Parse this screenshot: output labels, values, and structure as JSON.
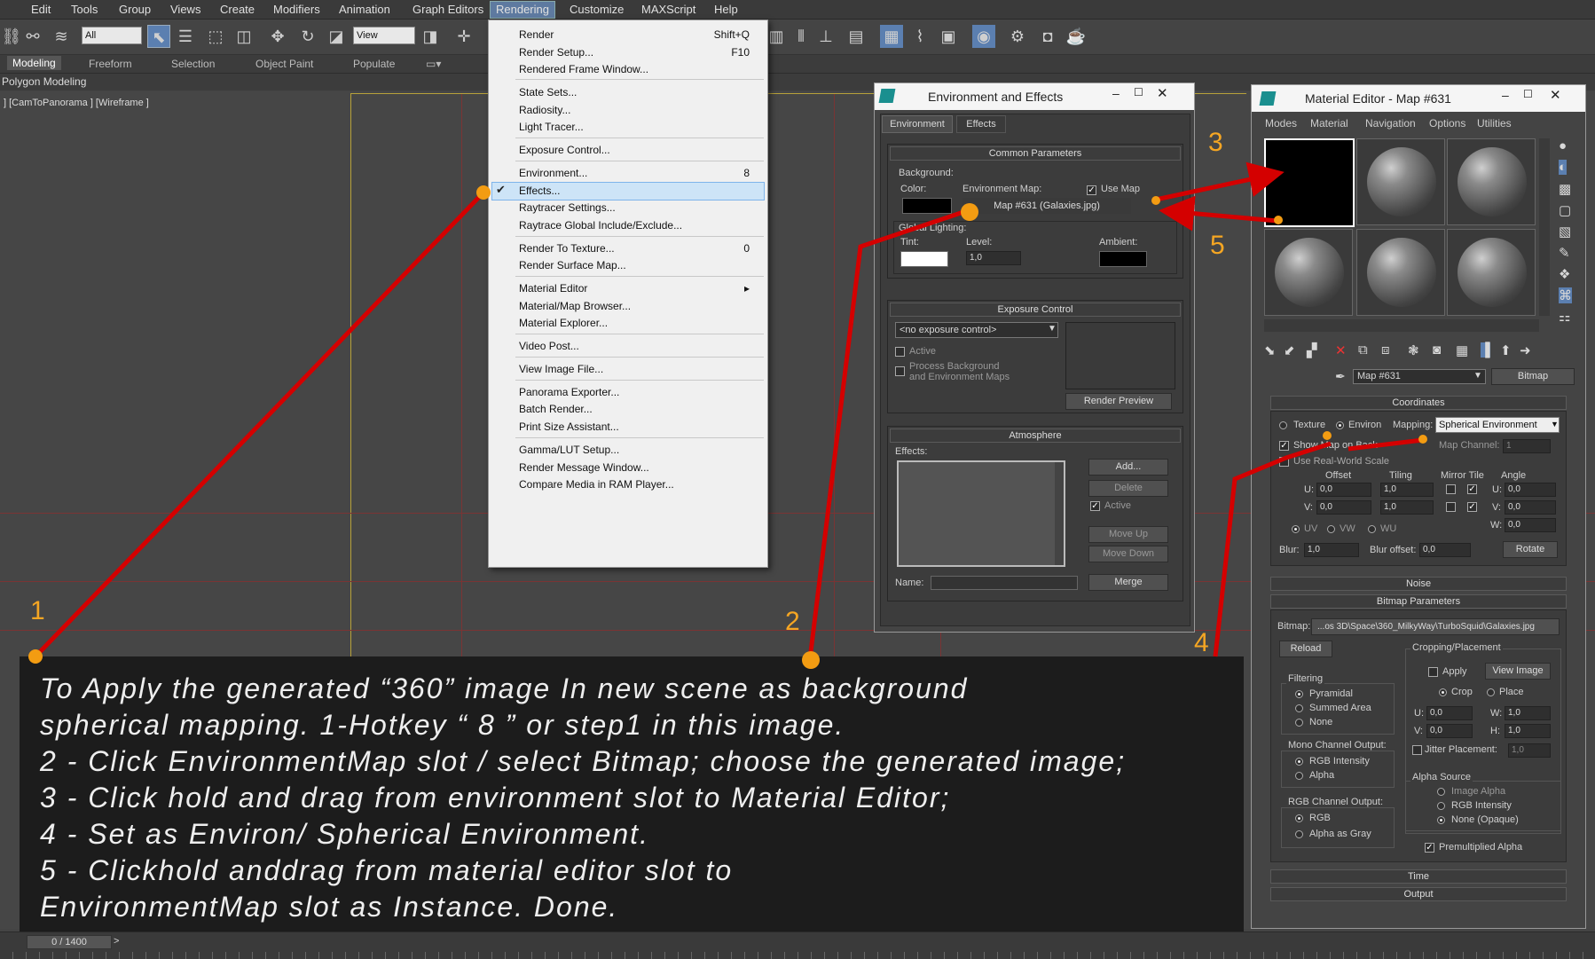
{
  "menubar": {
    "items": [
      "Edit",
      "Tools",
      "Group",
      "Views",
      "Create",
      "Modifiers",
      "Animation",
      "Graph Editors",
      "Rendering",
      "Customize",
      "MAXScript",
      "Help"
    ]
  },
  "toolbar": {
    "filter_value": "All",
    "refcoord_value": "View"
  },
  "ribbon": {
    "tabs": [
      "Modeling",
      "Freeform",
      "Selection",
      "Object Paint",
      "Populate"
    ],
    "sub": "Polygon Modeling"
  },
  "viewport": {
    "label": "] [CamToPanorama ] [Wireframe ]"
  },
  "rendering_menu": {
    "items": [
      {
        "label": "Render",
        "shortcut": "Shift+Q"
      },
      {
        "label": "Render Setup...",
        "shortcut": "F10"
      },
      {
        "label": "Rendered Frame Window...",
        "shortcut": ""
      },
      {
        "label": "State Sets...",
        "shortcut": ""
      },
      {
        "label": "Radiosity...",
        "shortcut": ""
      },
      {
        "label": "Light Tracer...",
        "shortcut": ""
      },
      {
        "label": "Exposure Control...",
        "shortcut": ""
      },
      {
        "label": "Environment...",
        "shortcut": "8"
      },
      {
        "label": "Effects...",
        "shortcut": ""
      },
      {
        "label": "Raytracer Settings...",
        "shortcut": ""
      },
      {
        "label": "Raytrace Global Include/Exclude...",
        "shortcut": ""
      },
      {
        "label": "Render To Texture...",
        "shortcut": "0"
      },
      {
        "label": "Render Surface Map...",
        "shortcut": ""
      },
      {
        "label": "Material Editor",
        "shortcut": "▸"
      },
      {
        "label": "Material/Map Browser...",
        "shortcut": ""
      },
      {
        "label": "Material Explorer...",
        "shortcut": ""
      },
      {
        "label": "Video Post...",
        "shortcut": ""
      },
      {
        "label": "View Image File...",
        "shortcut": ""
      },
      {
        "label": "Panorama Exporter...",
        "shortcut": ""
      },
      {
        "label": "Batch Render...",
        "shortcut": ""
      },
      {
        "label": "Print Size Assistant...",
        "shortcut": ""
      },
      {
        "label": "Gamma/LUT Setup...",
        "shortcut": ""
      },
      {
        "label": "Render Message Window...",
        "shortcut": ""
      },
      {
        "label": "Compare Media in RAM Player...",
        "shortcut": ""
      }
    ]
  },
  "env": {
    "title": "Environment and Effects",
    "tab_env": "Environment",
    "tab_fx": "Effects",
    "common": "Common Parameters",
    "background": "Background:",
    "color": "Color:",
    "envmap": "Environment Map:",
    "usemap": "Use Map",
    "mapname": "Map #631 (Galaxies.jpg)",
    "global": "Global Lighting:",
    "tint": "Tint:",
    "level": "Level:",
    "level_val": "1,0",
    "ambient": "Ambient:",
    "exposure": "Exposure Control",
    "exp_select": "<no exposure control>",
    "active": "Active",
    "process1": "Process Background",
    "process2": "and Environment Maps",
    "render_preview": "Render Preview",
    "atmos": "Atmosphere",
    "effects": "Effects:",
    "add": "Add...",
    "delete": "Delete",
    "atm_active": "Active",
    "move_up": "Move Up",
    "move_down": "Move Down",
    "name": "Name:",
    "merge": "Merge"
  },
  "mat": {
    "title": "Material Editor - Map #631",
    "menus": [
      "Modes",
      "Material",
      "Navigation",
      "Options",
      "Utilities"
    ],
    "map_name": "Map #631",
    "type": "Bitmap",
    "coords": "Coordinates",
    "texture": "Texture",
    "environ": "Environ",
    "mapping": "Mapping:",
    "mapping_val": "Spherical Environment",
    "showmap": "Show Map on Back",
    "mapchan": "Map Channel:",
    "mapchan_val": "1",
    "realworld": "Use Real-World Scale",
    "offset": "Offset",
    "tiling": "Tiling",
    "mirror": "Mirror Tile",
    "angle": "Angle",
    "u": "U:",
    "v": "V:",
    "w": "W:",
    "off_u": "0,0",
    "off_v": "0,0",
    "til_u": "1,0",
    "til_v": "1,0",
    "ang_u": "0,0",
    "ang_v": "0,0",
    "ang_w": "0,0",
    "uv": "UV",
    "vw": "VW",
    "wu": "WU",
    "blur": "Blur:",
    "blur_val": "1,0",
    "bluroff": "Blur offset:",
    "bluroff_val": "0,0",
    "rotate": "Rotate",
    "noise": "Noise",
    "bitmap_params": "Bitmap Parameters",
    "bitmap": "Bitmap:",
    "bitmap_path": "...os 3D\\Space\\360_MilkyWay\\TurboSquid\\Galaxies.jpg",
    "reload": "Reload",
    "crop": "Cropping/Placement",
    "apply": "Apply",
    "view_image": "View Image",
    "crop_r": "Crop",
    "place_r": "Place",
    "filtering": "Filtering",
    "pyramidal": "Pyramidal",
    "summed": "Summed Area",
    "none": "None",
    "cu": "U:",
    "cu_val": "0,0",
    "cw": "W:",
    "cw_val": "1,0",
    "cv": "V:",
    "cv_val": "0,0",
    "ch": "H:",
    "ch_val": "1,0",
    "jitter": "Jitter Placement:",
    "jitter_val": "1,0",
    "mono": "Mono Channel Output:",
    "rgbint": "RGB Intensity",
    "alpha": "Alpha",
    "alphasrc": "Alpha Source",
    "imgalpha": "Image Alpha",
    "rgbint2": "RGB Intensity",
    "noneopq": "None (Opaque)",
    "rgbout": "RGB Channel Output:",
    "rgb": "RGB",
    "alphagray": "Alpha as Gray",
    "premult": "Premultiplied Alpha",
    "time": "Time",
    "output": "Output"
  },
  "instructions": [
    "To Apply the generated “360” image In new scene as background",
    "spherical mapping. 1-Hotkey “ 8 ” or step1 in this image.",
    "2 - Click EnvironmentMap slot / select Bitmap; choose the generated image;",
    "3 - Click hold and drag from environment slot to Material Editor;",
    "4 - Set as Environ/ Spherical Environment.",
    "5 - Clickhold anddrag from material editor slot to",
    "EnvironmentMap slot as Instance. Done."
  ],
  "steps": [
    "1",
    "2",
    "3",
    "4",
    "5"
  ],
  "status": {
    "frames": "0 / 1400"
  },
  "colors": {
    "arrow": "#d40000",
    "marker": "#f39c12",
    "step_number": "#f5a623"
  }
}
